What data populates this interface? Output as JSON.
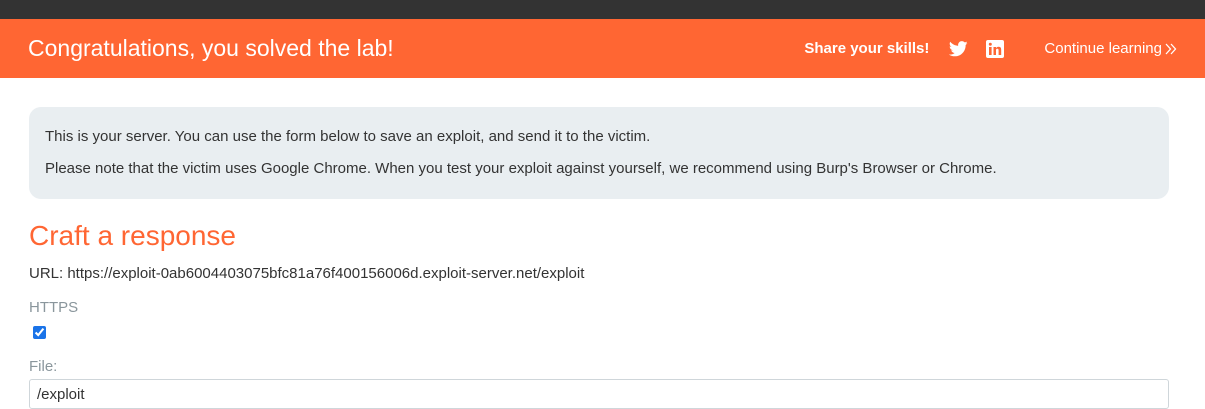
{
  "banner": {
    "title": "Congratulations, you solved the lab!",
    "share_label": "Share your skills!",
    "continue_label": "Continue learning",
    "icons": [
      "twitter-icon",
      "linkedin-icon",
      "double-chevron-right-icon"
    ],
    "color": "#ff6633"
  },
  "notice": {
    "line1": "This is your server. You can use the form below to save an exploit, and send it to the victim.",
    "line2": "Please note that the victim uses Google Chrome. When you test your exploit against yourself, we recommend using Burp's Browser or Chrome."
  },
  "form": {
    "heading": "Craft a response",
    "url_text": "URL: https://exploit-0ab6004403075bfc81a76f400156006d.exploit-server.net/exploit",
    "https_label": "HTTPS",
    "https_checked": true,
    "file_label": "File:",
    "file_value": "/exploit"
  }
}
